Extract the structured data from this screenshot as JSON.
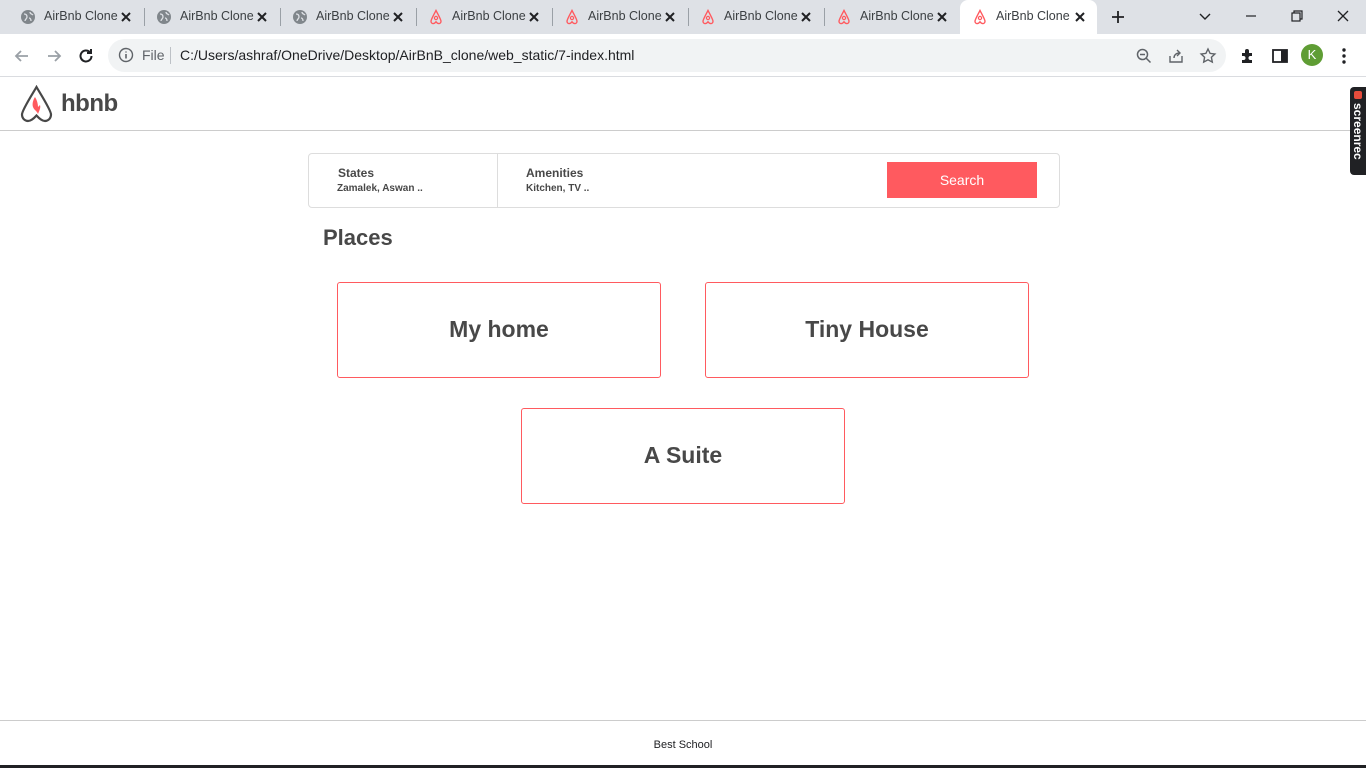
{
  "browser": {
    "tabs": [
      {
        "title": "AirBnb Clone",
        "icon": "globe-icon",
        "active": false
      },
      {
        "title": "AirBnb Clone",
        "icon": "globe-icon",
        "active": false
      },
      {
        "title": "AirBnb Clone",
        "icon": "globe-icon",
        "active": false
      },
      {
        "title": "AirBnb Clone",
        "icon": "airbnb-logo-icon",
        "active": false
      },
      {
        "title": "AirBnb Clone",
        "icon": "airbnb-logo-icon",
        "active": false
      },
      {
        "title": "AirBnb Clone",
        "icon": "airbnb-logo-icon",
        "active": false
      },
      {
        "title": "AirBnb Clone",
        "icon": "airbnb-logo-icon",
        "active": false
      },
      {
        "title": "AirBnb Clone",
        "icon": "airbnb-logo-icon",
        "active": true
      }
    ],
    "omnibox": {
      "scheme_label": "File",
      "url": "C:/Users/ashraf/OneDrive/Desktop/AirBnB_clone/web_static/7-index.html"
    },
    "profile_initial": "K",
    "colors": {
      "tabstrip": "#dee1e6",
      "omnibox": "#f1f3f4",
      "profile": "#5f9d34"
    }
  },
  "extension_badge": {
    "label": "screenrec"
  },
  "header": {
    "logo_text": "hbnb"
  },
  "filters": {
    "states": {
      "title": "States",
      "value": "Zamalek, Aswan .."
    },
    "amenities": {
      "title": "Amenities",
      "value": "Kitchen, TV .."
    },
    "search_label": "Search"
  },
  "places": {
    "title": "Places",
    "items": [
      {
        "name": "My home"
      },
      {
        "name": "Tiny House"
      },
      {
        "name": "A Suite"
      }
    ]
  },
  "footer": {
    "text": "Best School"
  },
  "colors": {
    "accent": "#ff5a5f",
    "text": "#484848",
    "border": "#cccccc"
  }
}
